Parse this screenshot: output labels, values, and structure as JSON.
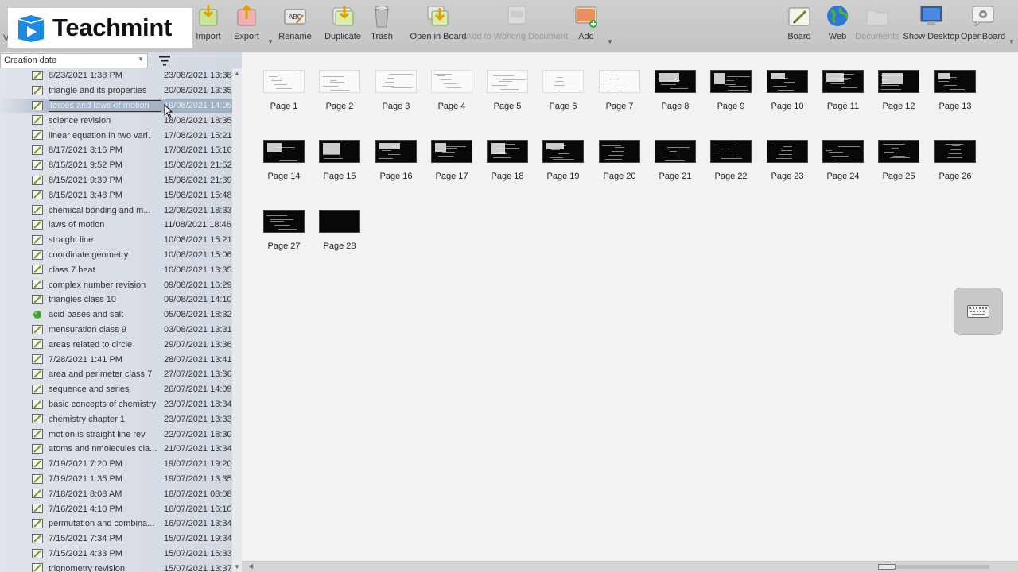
{
  "brand": {
    "name": "Teachmint",
    "color": "#1e88e5"
  },
  "toolbar": {
    "partial_left_label": "Vi",
    "buttons": [
      {
        "id": "import",
        "label": "Import",
        "icon": "import-icon",
        "enabled": true
      },
      {
        "id": "export",
        "label": "Export",
        "icon": "export-icon",
        "enabled": true,
        "has_dropdown": true
      },
      {
        "id": "rename",
        "label": "Rename",
        "icon": "rename-icon",
        "enabled": true
      },
      {
        "id": "duplicate",
        "label": "Duplicate",
        "icon": "duplicate-icon",
        "enabled": true
      },
      {
        "id": "trash",
        "label": "Trash",
        "icon": "trash-icon",
        "enabled": true
      },
      {
        "id": "open-in-board",
        "label": "Open in Board",
        "icon": "open-in-board-icon",
        "enabled": true
      },
      {
        "id": "add-to-working-document",
        "label": "Add to Working Document",
        "icon": "add-to-document-icon",
        "enabled": false
      },
      {
        "id": "add",
        "label": "Add",
        "icon": "add-page-icon",
        "enabled": true,
        "has_dropdown": true
      },
      {
        "id": "board",
        "label": "Board",
        "icon": "board-icon",
        "enabled": true
      },
      {
        "id": "web",
        "label": "Web",
        "icon": "globe-icon",
        "enabled": true
      },
      {
        "id": "documents",
        "label": "Documents",
        "icon": "folder-icon",
        "enabled": false
      },
      {
        "id": "show-desktop",
        "label": "Show Desktop",
        "icon": "desktop-icon",
        "enabled": true
      },
      {
        "id": "openboard",
        "label": "OpenBoard",
        "icon": "settings-icon",
        "enabled": true,
        "has_dropdown": true
      }
    ]
  },
  "sidebar": {
    "sort_by": "Creation date",
    "documents": [
      {
        "name": "8/23/2021 1:38 PM",
        "date": "23/08/2021 13:38",
        "icon": "document-icon"
      },
      {
        "name": "triangle and its properties",
        "date": "20/08/2021 13:35",
        "icon": "document-icon"
      },
      {
        "name": "forces and laws of motion",
        "date": "19/08/2021 14:05",
        "icon": "document-icon",
        "selected": true
      },
      {
        "name": "science revision",
        "date": "18/08/2021 18:35",
        "icon": "document-icon"
      },
      {
        "name": "linear equation in two vari.",
        "date": "17/08/2021 15:21",
        "icon": "document-icon"
      },
      {
        "name": "8/17/2021 3:16 PM",
        "date": "17/08/2021 15:16",
        "icon": "document-icon"
      },
      {
        "name": "8/15/2021 9:52 PM",
        "date": "15/08/2021 21:52",
        "icon": "document-icon"
      },
      {
        "name": "8/15/2021 9:39 PM",
        "date": "15/08/2021 21:39",
        "icon": "document-icon"
      },
      {
        "name": "8/15/2021 3:48 PM",
        "date": "15/08/2021 15:48",
        "icon": "document-icon"
      },
      {
        "name": "chemical bonding and m...",
        "date": "12/08/2021 18:33",
        "icon": "document-icon"
      },
      {
        "name": "laws of motion",
        "date": "11/08/2021 18:46",
        "icon": "document-icon"
      },
      {
        "name": "straight line",
        "date": "10/08/2021 15:21",
        "icon": "document-icon"
      },
      {
        "name": "coordinate geometry",
        "date": "10/08/2021 15:06",
        "icon": "document-icon"
      },
      {
        "name": "class 7 heat",
        "date": "10/08/2021 13:35",
        "icon": "document-icon"
      },
      {
        "name": "complex number revision",
        "date": "09/08/2021 16:29",
        "icon": "document-icon"
      },
      {
        "name": "triangles class 10",
        "date": "09/08/2021 14:10",
        "icon": "document-icon"
      },
      {
        "name": "acid bases and salt",
        "date": "05/08/2021 18:32",
        "icon": "active-document-icon"
      },
      {
        "name": "mensuration class 9",
        "date": "03/08/2021 13:31",
        "icon": "document-icon"
      },
      {
        "name": "areas related to circle",
        "date": "29/07/2021 13:36",
        "icon": "document-icon"
      },
      {
        "name": "7/28/2021 1:41 PM",
        "date": "28/07/2021 13:41",
        "icon": "document-icon"
      },
      {
        "name": "area and perimeter class 7",
        "date": "27/07/2021 13:36",
        "icon": "document-icon"
      },
      {
        "name": "sequence and series",
        "date": "26/07/2021 14:09",
        "icon": "document-icon"
      },
      {
        "name": "basic concepts of chemistry",
        "date": "23/07/2021 18:34",
        "icon": "document-icon"
      },
      {
        "name": "chemistry chapter 1",
        "date": "23/07/2021 13:33",
        "icon": "document-icon"
      },
      {
        "name": "motion is straight line rev",
        "date": "22/07/2021 18:30",
        "icon": "document-icon"
      },
      {
        "name": "atoms and nmolecules cla...",
        "date": "21/07/2021 13:34",
        "icon": "document-icon"
      },
      {
        "name": "7/19/2021 7:20 PM",
        "date": "19/07/2021 19:20",
        "icon": "document-icon"
      },
      {
        "name": "7/19/2021 1:35 PM",
        "date": "19/07/2021 13:35",
        "icon": "document-icon"
      },
      {
        "name": "7/18/2021 8:08 AM",
        "date": "18/07/2021 08:08",
        "icon": "document-icon"
      },
      {
        "name": "7/16/2021 4:10 PM",
        "date": "16/07/2021 16:10",
        "icon": "document-icon"
      },
      {
        "name": "permutation and combina...",
        "date": "16/07/2021 13:34",
        "icon": "document-icon"
      },
      {
        "name": "7/15/2021 7:34 PM",
        "date": "15/07/2021 19:34",
        "icon": "document-icon"
      },
      {
        "name": "7/15/2021 4:33 PM",
        "date": "15/07/2021 16:33",
        "icon": "document-icon"
      },
      {
        "name": "trignometry revision",
        "date": "15/07/2021 13:37",
        "icon": "document-icon"
      }
    ]
  },
  "pages": [
    {
      "label": "Page 1",
      "theme": "light"
    },
    {
      "label": "Page 2",
      "theme": "light"
    },
    {
      "label": "Page 3",
      "theme": "light"
    },
    {
      "label": "Page 4",
      "theme": "light"
    },
    {
      "label": "Page 5",
      "theme": "light"
    },
    {
      "label": "Page 6",
      "theme": "light"
    },
    {
      "label": "Page 7",
      "theme": "light"
    },
    {
      "label": "Page 8",
      "theme": "dark"
    },
    {
      "label": "Page 9",
      "theme": "dark"
    },
    {
      "label": "Page 10",
      "theme": "dark"
    },
    {
      "label": "Page 11",
      "theme": "dark"
    },
    {
      "label": "Page 12",
      "theme": "dark"
    },
    {
      "label": "Page 13",
      "theme": "dark"
    },
    {
      "label": "Page 14",
      "theme": "dark"
    },
    {
      "label": "Page 15",
      "theme": "dark"
    },
    {
      "label": "Page 16",
      "theme": "dark"
    },
    {
      "label": "Page 17",
      "theme": "dark"
    },
    {
      "label": "Page 18",
      "theme": "dark"
    },
    {
      "label": "Page 19",
      "theme": "dark"
    },
    {
      "label": "Page 20",
      "theme": "dark"
    },
    {
      "label": "Page 21",
      "theme": "dark"
    },
    {
      "label": "Page 22",
      "theme": "dark"
    },
    {
      "label": "Page 23",
      "theme": "dark"
    },
    {
      "label": "Page 24",
      "theme": "dark"
    },
    {
      "label": "Page 25",
      "theme": "dark"
    },
    {
      "label": "Page 26",
      "theme": "dark"
    },
    {
      "label": "Page 27",
      "theme": "dark"
    },
    {
      "label": "Page 28",
      "theme": "dark"
    }
  ],
  "keyboard_button": {
    "icon": "keyboard-icon"
  }
}
